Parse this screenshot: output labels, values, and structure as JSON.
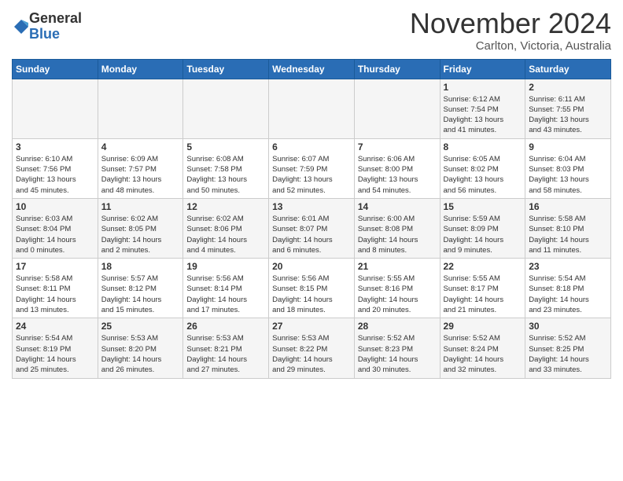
{
  "header": {
    "logo_general": "General",
    "logo_blue": "Blue",
    "month_title": "November 2024",
    "location": "Carlton, Victoria, Australia"
  },
  "weekdays": [
    "Sunday",
    "Monday",
    "Tuesday",
    "Wednesday",
    "Thursday",
    "Friday",
    "Saturday"
  ],
  "weeks": [
    [
      {
        "day": "",
        "info": ""
      },
      {
        "day": "",
        "info": ""
      },
      {
        "day": "",
        "info": ""
      },
      {
        "day": "",
        "info": ""
      },
      {
        "day": "",
        "info": ""
      },
      {
        "day": "1",
        "info": "Sunrise: 6:12 AM\nSunset: 7:54 PM\nDaylight: 13 hours\nand 41 minutes."
      },
      {
        "day": "2",
        "info": "Sunrise: 6:11 AM\nSunset: 7:55 PM\nDaylight: 13 hours\nand 43 minutes."
      }
    ],
    [
      {
        "day": "3",
        "info": "Sunrise: 6:10 AM\nSunset: 7:56 PM\nDaylight: 13 hours\nand 45 minutes."
      },
      {
        "day": "4",
        "info": "Sunrise: 6:09 AM\nSunset: 7:57 PM\nDaylight: 13 hours\nand 48 minutes."
      },
      {
        "day": "5",
        "info": "Sunrise: 6:08 AM\nSunset: 7:58 PM\nDaylight: 13 hours\nand 50 minutes."
      },
      {
        "day": "6",
        "info": "Sunrise: 6:07 AM\nSunset: 7:59 PM\nDaylight: 13 hours\nand 52 minutes."
      },
      {
        "day": "7",
        "info": "Sunrise: 6:06 AM\nSunset: 8:00 PM\nDaylight: 13 hours\nand 54 minutes."
      },
      {
        "day": "8",
        "info": "Sunrise: 6:05 AM\nSunset: 8:02 PM\nDaylight: 13 hours\nand 56 minutes."
      },
      {
        "day": "9",
        "info": "Sunrise: 6:04 AM\nSunset: 8:03 PM\nDaylight: 13 hours\nand 58 minutes."
      }
    ],
    [
      {
        "day": "10",
        "info": "Sunrise: 6:03 AM\nSunset: 8:04 PM\nDaylight: 14 hours\nand 0 minutes."
      },
      {
        "day": "11",
        "info": "Sunrise: 6:02 AM\nSunset: 8:05 PM\nDaylight: 14 hours\nand 2 minutes."
      },
      {
        "day": "12",
        "info": "Sunrise: 6:02 AM\nSunset: 8:06 PM\nDaylight: 14 hours\nand 4 minutes."
      },
      {
        "day": "13",
        "info": "Sunrise: 6:01 AM\nSunset: 8:07 PM\nDaylight: 14 hours\nand 6 minutes."
      },
      {
        "day": "14",
        "info": "Sunrise: 6:00 AM\nSunset: 8:08 PM\nDaylight: 14 hours\nand 8 minutes."
      },
      {
        "day": "15",
        "info": "Sunrise: 5:59 AM\nSunset: 8:09 PM\nDaylight: 14 hours\nand 9 minutes."
      },
      {
        "day": "16",
        "info": "Sunrise: 5:58 AM\nSunset: 8:10 PM\nDaylight: 14 hours\nand 11 minutes."
      }
    ],
    [
      {
        "day": "17",
        "info": "Sunrise: 5:58 AM\nSunset: 8:11 PM\nDaylight: 14 hours\nand 13 minutes."
      },
      {
        "day": "18",
        "info": "Sunrise: 5:57 AM\nSunset: 8:12 PM\nDaylight: 14 hours\nand 15 minutes."
      },
      {
        "day": "19",
        "info": "Sunrise: 5:56 AM\nSunset: 8:14 PM\nDaylight: 14 hours\nand 17 minutes."
      },
      {
        "day": "20",
        "info": "Sunrise: 5:56 AM\nSunset: 8:15 PM\nDaylight: 14 hours\nand 18 minutes."
      },
      {
        "day": "21",
        "info": "Sunrise: 5:55 AM\nSunset: 8:16 PM\nDaylight: 14 hours\nand 20 minutes."
      },
      {
        "day": "22",
        "info": "Sunrise: 5:55 AM\nSunset: 8:17 PM\nDaylight: 14 hours\nand 21 minutes."
      },
      {
        "day": "23",
        "info": "Sunrise: 5:54 AM\nSunset: 8:18 PM\nDaylight: 14 hours\nand 23 minutes."
      }
    ],
    [
      {
        "day": "24",
        "info": "Sunrise: 5:54 AM\nSunset: 8:19 PM\nDaylight: 14 hours\nand 25 minutes."
      },
      {
        "day": "25",
        "info": "Sunrise: 5:53 AM\nSunset: 8:20 PM\nDaylight: 14 hours\nand 26 minutes."
      },
      {
        "day": "26",
        "info": "Sunrise: 5:53 AM\nSunset: 8:21 PM\nDaylight: 14 hours\nand 27 minutes."
      },
      {
        "day": "27",
        "info": "Sunrise: 5:53 AM\nSunset: 8:22 PM\nDaylight: 14 hours\nand 29 minutes."
      },
      {
        "day": "28",
        "info": "Sunrise: 5:52 AM\nSunset: 8:23 PM\nDaylight: 14 hours\nand 30 minutes."
      },
      {
        "day": "29",
        "info": "Sunrise: 5:52 AM\nSunset: 8:24 PM\nDaylight: 14 hours\nand 32 minutes."
      },
      {
        "day": "30",
        "info": "Sunrise: 5:52 AM\nSunset: 8:25 PM\nDaylight: 14 hours\nand 33 minutes."
      }
    ]
  ]
}
